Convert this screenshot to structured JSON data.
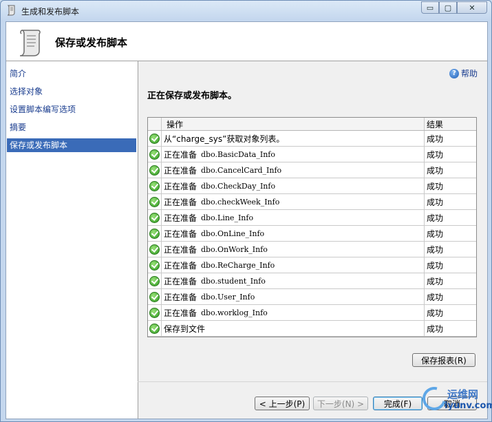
{
  "window": {
    "title": "生成和发布脚本",
    "caption": {
      "minimize": "▭",
      "maximize": "▢",
      "close": "✕"
    }
  },
  "header": {
    "title": "保存或发布脚本"
  },
  "nav": {
    "items": [
      {
        "label": "简介",
        "selected": false
      },
      {
        "label": "选择对象",
        "selected": false
      },
      {
        "label": "设置脚本编写选项",
        "selected": false
      },
      {
        "label": "摘要",
        "selected": false
      },
      {
        "label": "保存或发布脚本",
        "selected": true
      }
    ]
  },
  "help": {
    "label": "帮助",
    "icon": "help-icon"
  },
  "status": "正在保存或发布脚本。",
  "grid": {
    "headers": {
      "op": "操作",
      "result": "结果"
    },
    "rows": [
      {
        "prefix": "从“charge_sys”获取对象列表。",
        "obj": "",
        "result": "成功"
      },
      {
        "prefix": "正在准备",
        "obj": "dbo.BasicData_Info",
        "result": "成功"
      },
      {
        "prefix": "正在准备",
        "obj": "dbo.CancelCard_Info",
        "result": "成功"
      },
      {
        "prefix": "正在准备",
        "obj": "dbo.CheckDay_Info",
        "result": "成功"
      },
      {
        "prefix": "正在准备",
        "obj": "dbo.checkWeek_Info",
        "result": "成功"
      },
      {
        "prefix": "正在准备",
        "obj": "dbo.Line_Info",
        "result": "成功"
      },
      {
        "prefix": "正在准备",
        "obj": "dbo.OnLine_Info",
        "result": "成功"
      },
      {
        "prefix": "正在准备",
        "obj": "dbo.OnWork_Info",
        "result": "成功"
      },
      {
        "prefix": "正在准备",
        "obj": "dbo.ReCharge_Info",
        "result": "成功"
      },
      {
        "prefix": "正在准备",
        "obj": "dbo.student_Info",
        "result": "成功"
      },
      {
        "prefix": "正在准备",
        "obj": "dbo.User_Info",
        "result": "成功"
      },
      {
        "prefix": "正在准备",
        "obj": "dbo.worklog_Info",
        "result": "成功"
      },
      {
        "prefix": "保存到文件",
        "obj": "",
        "result": "成功"
      }
    ]
  },
  "buttons": {
    "save_report": "保存报表(R)",
    "prev": "< 上一步(P)",
    "next": "下一步(N) >",
    "finish": "完成(F)",
    "cancel": "取消"
  },
  "watermark": {
    "brand": "运维网",
    "url": "iyunv.com"
  },
  "colors": {
    "nav_selected": "#3a6bb8",
    "link": "#1a3d8f",
    "success": "#2c9a1e"
  }
}
